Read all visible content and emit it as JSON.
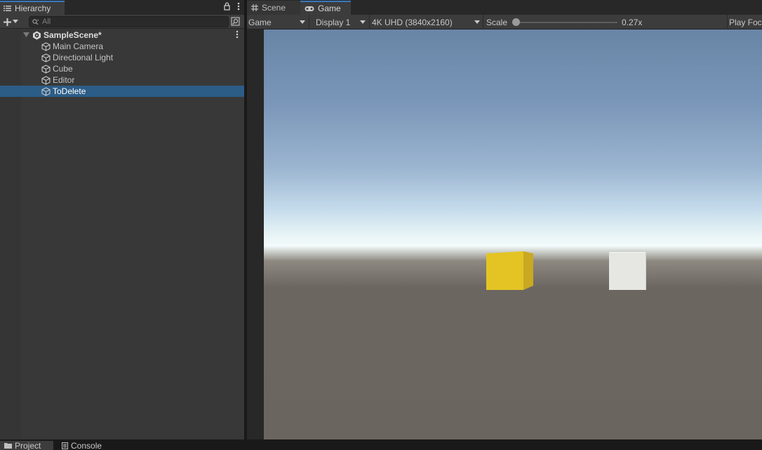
{
  "hierarchy": {
    "tab_label": "Hierarchy",
    "search_placeholder": "All",
    "scene_name": "SampleScene*",
    "items": [
      {
        "label": "Main Camera",
        "selected": false
      },
      {
        "label": "Directional Light",
        "selected": false
      },
      {
        "label": "Cube",
        "selected": false
      },
      {
        "label": "Editor",
        "selected": false
      },
      {
        "label": "ToDelete",
        "selected": true
      }
    ]
  },
  "game": {
    "tabs": [
      {
        "label": "Scene",
        "active": false
      },
      {
        "label": "Game",
        "active": true
      }
    ],
    "toolbar": {
      "view_mode": "Game",
      "display": "Display 1",
      "resolution": "4K UHD (3840x2160)",
      "scale_label": "Scale",
      "scale_value": "0.27x",
      "scale_fraction": 0.0,
      "play_focus": "Play Focused"
    },
    "scene": {
      "cube_colors": [
        "#e3c424",
        "#e6e6e3"
      ],
      "sky_color": "#6985a6",
      "horizon_color": "#f3fbfa",
      "ground_color": "#6b6560"
    }
  },
  "bottom_tabs": [
    {
      "label": "Project",
      "active": true
    },
    {
      "label": "Console",
      "active": false
    }
  ],
  "colors": {
    "selection": "#2c5d87",
    "tab_accent": "#3a79bb",
    "panel_bg": "#383838"
  }
}
